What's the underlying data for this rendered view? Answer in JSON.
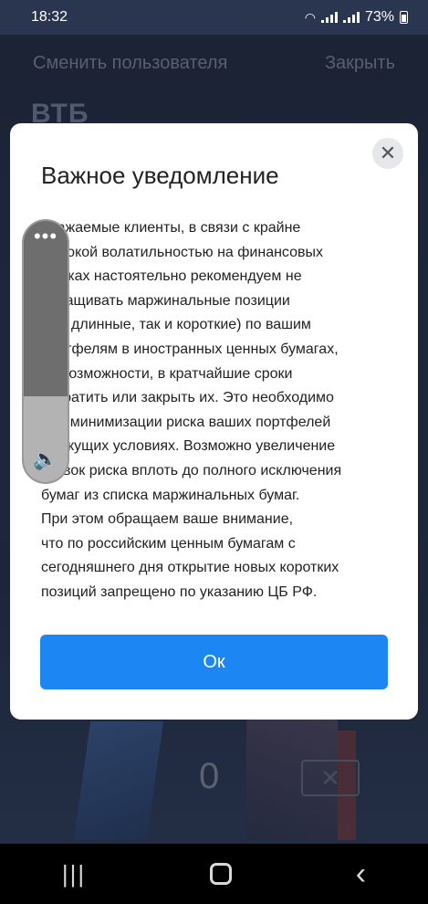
{
  "status_bar": {
    "time": "18:32",
    "battery": "73%"
  },
  "app": {
    "switch_user": "Сменить пользователя",
    "close": "Закрыть",
    "logo": "ВТБ",
    "pin_digit": "0"
  },
  "modal": {
    "title": "Важное уведомление",
    "body_lines": [
      "Уважаемые клиенты, в связи с крайне",
      "высокой волатильностью на финансовых",
      "рынках настоятельно рекомендуем не",
      "наращивать маржинальные позиции",
      "(как длинные, так и короткие) по вашим",
      "портфелям в иностранных ценных бумагах,",
      "по возможности, в кратчайшие сроки",
      "сократить или закрыть их. Это необходимо",
      "для минимизации риска ваших портфелей",
      "в текущих условиях.  Возможно увеличение",
      "ставок риска вплоть до полного исключения",
      "бумаг из списка маржинальных бумаг.",
      "При этом обращаем ваше внимание,",
      "что по российским ценным бумагам с",
      "сегодняшнего дня открытие новых коротких",
      "позиций запрещено по указанию ЦБ РФ."
    ],
    "ok_label": "Ок"
  },
  "volume": {
    "level": 0.33
  }
}
